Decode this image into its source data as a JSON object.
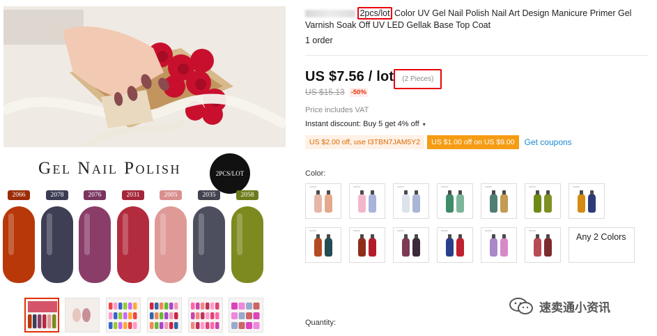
{
  "gallery": {
    "banner_title": "Gel Nail Polish",
    "badge": "2PCS/LOT",
    "swatches": [
      {
        "code": "2066",
        "color": "#b8380a",
        "label_bg": "#9c2c06"
      },
      {
        "code": "2078",
        "color": "#3e3f55",
        "label_bg": "#3b3c52"
      },
      {
        "code": "2076",
        "color": "#8a3d69",
        "label_bg": "#7a3460"
      },
      {
        "code": "2031",
        "color": "#b22c3e",
        "label_bg": "#a3263a"
      },
      {
        "code": "2005",
        "color": "#df9a97",
        "label_bg": "#d88f8d"
      },
      {
        "code": "2035",
        "color": "#4d4f5f",
        "label_bg": "#42434f"
      },
      {
        "code": "2058",
        "color": "#7d8a1f",
        "label_bg": "#6f7b1b"
      }
    ],
    "thumbnail_count": 6
  },
  "product": {
    "title_highlight": "2pcs/lot",
    "title_rest": " Color UV Gel Nail Polish Nail Art Design Manicure Primer Gel Varnish Soak Off UV LED Gellak Base Top Coat",
    "orders": "1 order",
    "price": "US $7.56 / lot",
    "pieces": "(2 Pieces)",
    "original_price": "US $15.13",
    "discount": "-50%",
    "vat_note": "Price includes VAT",
    "instant_discount": "Instant discount: Buy 5 get 4% off",
    "coupon_1": "US $2.00 off, use I3TBN7JAM5Y2",
    "coupon_2": "US $1.00 off on US $9.00",
    "get_coupons": "Get coupons",
    "color_label": "Color:",
    "any_two_colors": "Any 2 Colors",
    "quantity_label": "Quantity:"
  },
  "color_options": [
    [
      "#e6b6a6",
      "#e4a98a"
    ],
    [
      "#f2b7cc",
      "#a9b4dc"
    ],
    [
      "#dde3ea",
      "#aab6d6"
    ],
    [
      "#3f8c68",
      "#7cb59a"
    ],
    [
      "#4f7f74",
      "#c49a55"
    ],
    [
      "#6d8a14",
      "#7e9023"
    ],
    [
      "#d48b14",
      "#2d3a78"
    ],
    [
      "#b34a22",
      "#244c55"
    ],
    [
      "#8e2e1a",
      "#b31c28"
    ],
    [
      "#7c3a55",
      "#3a2a3a"
    ],
    [
      "#2a3f8a",
      "#c1202e"
    ],
    [
      "#a987c9",
      "#d889c8"
    ],
    [
      "#b84a55",
      "#7d2a2e"
    ],
    [
      "#f4f4f4",
      "#f4f4f4"
    ]
  ],
  "watermark": "速卖通小资讯"
}
